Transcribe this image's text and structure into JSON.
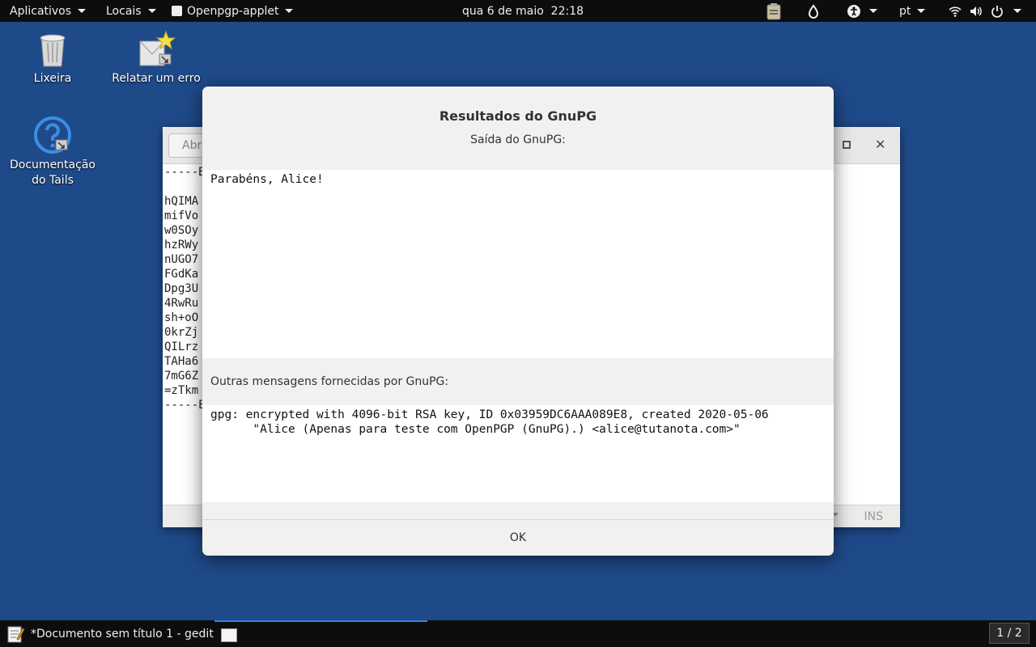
{
  "topbar": {
    "applications": "Aplicativos",
    "places": "Locais",
    "applet": "Openpgp-applet",
    "clock": "qua 6 de maio  22:18",
    "language": "pt"
  },
  "desktop": {
    "trash": "Lixeira",
    "report_bug": "Relatar um erro",
    "docs": "Documentação\ndo Tails"
  },
  "gedit": {
    "open_button": "Abrir",
    "lines": [
      "-----BEGIN PGP MESSAGE-----",
      "",
      "hQIMA",
      "mifVo",
      "w0SOy",
      "hzRWy",
      "nUGO7",
      "FGdKa",
      "Dpg3U",
      "4RwRu",
      "sh+oO",
      "0krZj",
      "QILrz",
      "TAHa6",
      "7mG6Z",
      "=zTkm",
      "-----END PGP MESSAGE-----"
    ],
    "ins": "INS"
  },
  "dialog": {
    "title": "Resultados do GnuPG",
    "subtitle": "Saída do GnuPG:",
    "output": "Parabéns, Alice!",
    "other_label": "Outras mensagens fornecidas por GnuPG:",
    "messages": "gpg: encrypted with 4096-bit RSA key, ID 0x03959DC6AAA089E8, created 2020-05-06\n      \"Alice (Apenas para teste com OpenPGP (GnuPG).) <alice@tutanota.com>\"",
    "ok": "OK"
  },
  "taskbar": {
    "window_title": "*Documento sem título 1 - gedit",
    "workspace": "1 / 2"
  }
}
